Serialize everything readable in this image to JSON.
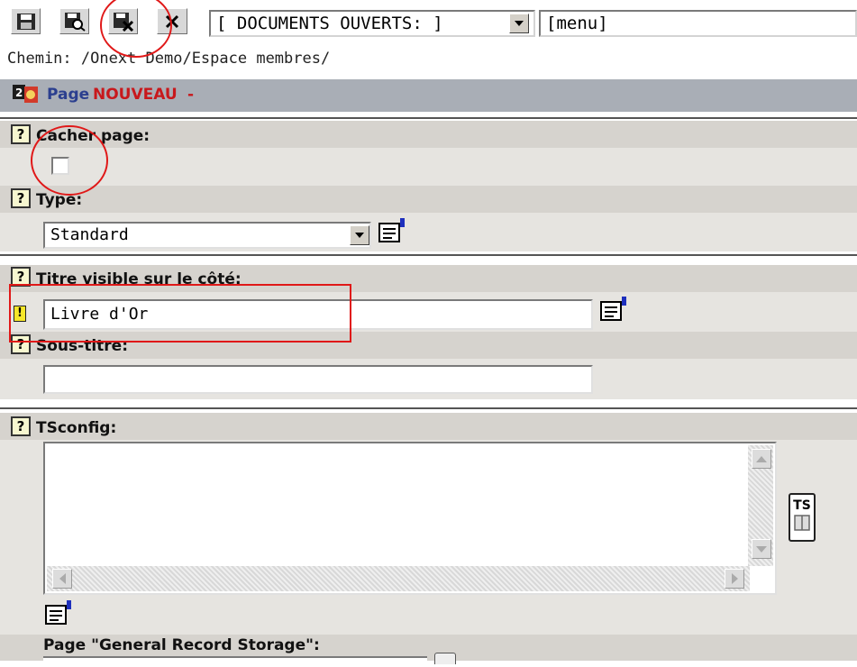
{
  "toolbar": {
    "buttons": [
      {
        "name": "save-icon"
      },
      {
        "name": "save-view-icon"
      },
      {
        "name": "save-close-icon"
      },
      {
        "name": "close-icon"
      }
    ],
    "documents_select": "[ DOCUMENTS OUVERTS: ]",
    "menu_field": "[menu]"
  },
  "path": "Chemin: /Onext Demo/Espace membres/",
  "header": {
    "prefix": "Page",
    "status": "NOUVEAU",
    "suffix": "-"
  },
  "fields": {
    "hide_page": {
      "label": "Cacher page:",
      "checked": false
    },
    "type": {
      "label": "Type:",
      "value": "Standard"
    },
    "nav_title": {
      "label": "Titre visible sur le côté:",
      "value": "Livre d'Or"
    },
    "subtitle": {
      "label": "Sous-titre:",
      "value": ""
    },
    "tsconfig": {
      "label": "TSconfig:",
      "value": "",
      "ts_button": "TS"
    },
    "storage": {
      "label": "Page \"General Record Storage\":"
    }
  },
  "help_glyph": "?",
  "required_glyph": "!",
  "colors": {
    "header_band": "#a9aeb6",
    "label_row": "#d6d3ce",
    "body_row": "#e6e4e0",
    "status_red": "#c8181c",
    "title_blue": "#2b3f8f",
    "annotation_red": "#e01818"
  }
}
